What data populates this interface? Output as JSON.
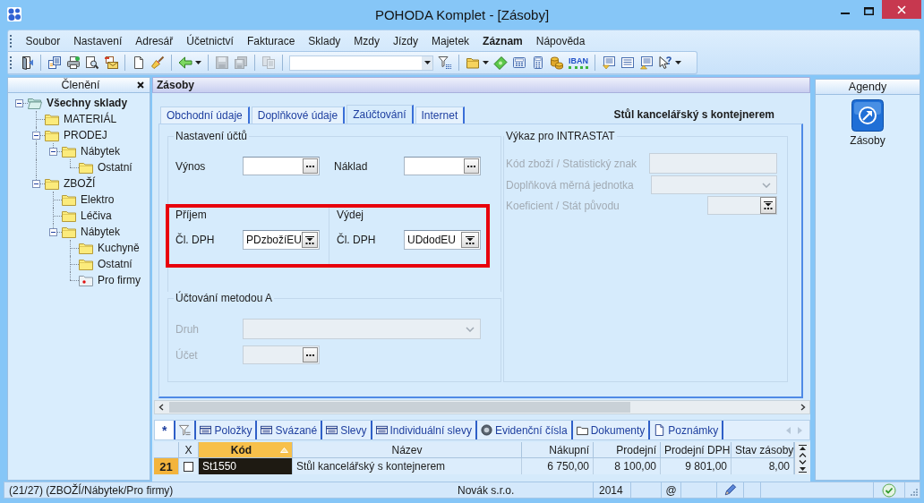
{
  "window": {
    "title": "POHODA Komplet - [Zásoby]"
  },
  "menu": [
    {
      "label": "Soubor",
      "emphasized": false
    },
    {
      "label": "Nastavení",
      "emphasized": false
    },
    {
      "label": "Adresář",
      "emphasized": false
    },
    {
      "label": "Účetnictví",
      "emphasized": false
    },
    {
      "label": "Fakturace",
      "emphasized": false
    },
    {
      "label": "Sklady",
      "emphasized": false
    },
    {
      "label": "Mzdy",
      "emphasized": false
    },
    {
      "label": "Jízdy",
      "emphasized": false
    },
    {
      "label": "Majetek",
      "emphasized": false
    },
    {
      "label": "Záznam",
      "emphasized": true
    },
    {
      "label": "Nápověda",
      "emphasized": false
    }
  ],
  "toolbar": [
    [
      {
        "kind": "exit",
        "disabled": false
      }
    ],
    [
      {
        "kind": "documents",
        "disabled": false
      },
      {
        "kind": "print",
        "disabled": false
      },
      {
        "kind": "preview",
        "disabled": false
      },
      {
        "kind": "mail",
        "disabled": false
      }
    ],
    [
      {
        "kind": "new",
        "disabled": false
      },
      {
        "kind": "brush",
        "disabled": false
      }
    ],
    [
      {
        "kind": "back",
        "disabled": false,
        "dropdown": true
      }
    ],
    [
      {
        "kind": "save",
        "disabled": true
      },
      {
        "kind": "save_copy",
        "disabled": true
      }
    ],
    [
      {
        "kind": "copy",
        "disabled": true
      }
    ],
    [
      {
        "kind": "combo",
        "disabled": false
      },
      {
        "kind": "filter",
        "disabled": false
      }
    ],
    [
      {
        "kind": "folder",
        "disabled": false,
        "dropdown": true
      },
      {
        "kind": "money",
        "disabled": false
      },
      {
        "kind": "calculator",
        "disabled": false
      },
      {
        "kind": "calculator_alt",
        "disabled": false
      },
      {
        "kind": "coins",
        "disabled": false
      },
      {
        "kind": "iban",
        "label": "IBAN",
        "disabled": false
      }
    ],
    [
      {
        "kind": "list_down",
        "disabled": false
      },
      {
        "kind": "list",
        "disabled": false
      },
      {
        "kind": "list_up",
        "disabled": false
      },
      {
        "kind": "help",
        "disabled": false,
        "dropdown": true
      }
    ]
  ],
  "sidebar": {
    "title": "Členění",
    "tree": [
      {
        "label": "Všechny sklady",
        "expanded": true,
        "selected": false,
        "children": [
          {
            "label": "MATERIÁL",
            "selected": false
          },
          {
            "label": "PRODEJ",
            "expanded": true,
            "selected": false,
            "children": [
              {
                "label": "Nábytek",
                "expanded": true,
                "selected": false,
                "children": [
                  {
                    "label": "Ostatní",
                    "selected": false
                  }
                ]
              }
            ]
          },
          {
            "label": "ZBOŽÍ",
            "expanded": true,
            "selected": false,
            "children": [
              {
                "label": "Elektro",
                "selected": false
              },
              {
                "label": "Léčiva",
                "selected": false
              },
              {
                "label": "Nábytek",
                "expanded": true,
                "selected": false,
                "children": [
                  {
                    "label": "Kuchyně",
                    "selected": false
                  },
                  {
                    "label": "Ostatní",
                    "selected": false
                  },
                  {
                    "label": "Pro firmy",
                    "selected": true
                  }
                ]
              }
            ]
          }
        ]
      }
    ]
  },
  "form": {
    "title": "Zásoby",
    "tabs": [
      {
        "label": "Obchodní údaje",
        "selected": false
      },
      {
        "label": "Doplňkové údaje",
        "selected": false
      },
      {
        "label": "Zaúčtování",
        "selected": true
      },
      {
        "label": "Internet",
        "selected": false
      }
    ],
    "record_name": "Stůl kancelářský s kontejnerem",
    "accounts": {
      "title": "Nastavení účtů",
      "fields": [
        {
          "label": "Výnos",
          "kind": "lookup",
          "disabled": false
        },
        {
          "label": "Náklad",
          "kind": "lookup",
          "disabled": false
        }
      ]
    },
    "vat": {
      "highlighted": true,
      "groups": [
        {
          "title": "Příjem",
          "label": "Čl. DPH",
          "value": "PDzbožíEU",
          "kind": "list_lookup",
          "disabled": false
        },
        {
          "title": "Výdej",
          "label": "Čl. DPH",
          "value": "UDdodEU",
          "kind": "list_lookup",
          "disabled": false
        }
      ]
    },
    "method_a": {
      "title": "Účtování metodou A",
      "fields": [
        {
          "label": "Druh",
          "kind": "dropdown",
          "disabled": true
        },
        {
          "label": "Účet",
          "kind": "lookup",
          "disabled": true
        }
      ]
    },
    "intrastat": {
      "title": "Výkaz pro INTRASTAT",
      "fields": [
        {
          "label": "Kód zboží / Statistický znak",
          "kind": "text",
          "disabled": true
        },
        {
          "label": "Doplňková měrná jednotka",
          "kind": "dropdown",
          "disabled": true
        },
        {
          "label": "Koeficient / Stát původu",
          "kind": "spinner",
          "disabled": true
        }
      ]
    }
  },
  "detail_tabs": [
    {
      "kind": "plain",
      "label": "*",
      "selected": true
    },
    {
      "kind": "filter",
      "selected": false
    },
    {
      "kind": "grid",
      "label": "Položky",
      "selected": false
    },
    {
      "kind": "grid",
      "label": "Svázané",
      "selected": false
    },
    {
      "kind": "grid",
      "label": "Slevy",
      "selected": false
    },
    {
      "kind": "grid",
      "label": "Individuální slevy",
      "selected": false
    },
    {
      "kind": "serial",
      "label": "Evidenční čísla",
      "selected": false
    },
    {
      "kind": "folder",
      "label": "Dokumenty",
      "selected": false
    },
    {
      "kind": "note",
      "label": "Poznámky",
      "selected": false
    }
  ],
  "table": {
    "check_header": "X",
    "columns": [
      {
        "label": "Kód",
        "sorted": true
      },
      {
        "label": "Název",
        "sorted": false
      },
      {
        "label": "Nákupní",
        "sorted": false
      },
      {
        "label": "Prodejní",
        "sorted": false
      },
      {
        "label": "Prodejní DPH",
        "sorted": false
      },
      {
        "label": "Stav zásoby",
        "sorted": false
      }
    ],
    "rows": [
      {
        "number": "21",
        "selected": true,
        "checked": false,
        "cells": [
          "St1550",
          "Stůl kancelářský s kontejnerem",
          "6 750,00",
          "8 100,00",
          "9 801,00",
          "8,00"
        ]
      }
    ]
  },
  "status_bar": {
    "path": "(21/27) (ZBOŽÍ/Nábytek/Pro firmy)",
    "company": "Novák s.r.o.",
    "year": "2014",
    "mail": "@"
  },
  "agendas": {
    "title": "Agendy",
    "items": [
      {
        "label": "Zásoby"
      }
    ]
  }
}
